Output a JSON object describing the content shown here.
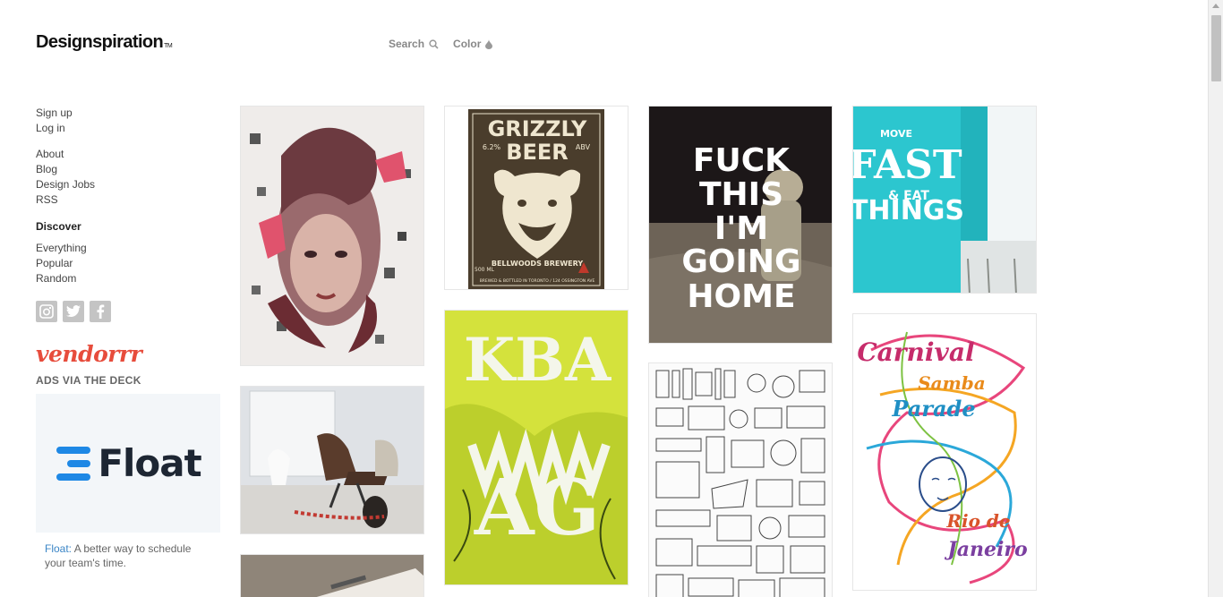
{
  "header": {
    "logo": "Designspiration",
    "logo_tm": "TM",
    "nav": [
      {
        "label": "Search",
        "icon": "search-icon"
      },
      {
        "label": "Color",
        "icon": "droplet-icon"
      }
    ]
  },
  "sidebar": {
    "account": [
      "Sign up",
      "Log in"
    ],
    "pages": [
      "About",
      "Blog",
      "Design Jobs",
      "RSS"
    ],
    "discover_heading": "Discover",
    "discover": [
      "Everything",
      "Popular",
      "Random"
    ],
    "social": [
      "instagram-icon",
      "twitter-icon",
      "facebook-icon"
    ],
    "vendor_logo": "vendorrr",
    "ads_heading": "ADS VIA THE DECK",
    "ad": {
      "brand": "Float",
      "link_text": "Float:",
      "body": "A better way to schedule your team's time."
    }
  },
  "tiles": [
    {
      "name": "tile-portrait-illustration",
      "caption": ""
    },
    {
      "name": "tile-grizzly-beer",
      "lines": [
        "GRIZZLY",
        "BEER",
        "6.2%",
        "ABV",
        "BELLWOODS BREWERY",
        "500 ML",
        "BREWED & BOTTLED IN TORONTO / 124 OSSINGTON AVE"
      ]
    },
    {
      "name": "tile-astronaut-poster",
      "lines": [
        "FUCK",
        "THIS",
        "I'M",
        "GOING",
        "HOME"
      ]
    },
    {
      "name": "tile-move-fast",
      "lines": [
        "MOVE",
        "FAST",
        "& EAT",
        "THINGS"
      ]
    },
    {
      "name": "tile-lounge-chair"
    },
    {
      "name": "tile-green-typography",
      "lines": [
        "KBA",
        "AG"
      ]
    },
    {
      "name": "tile-tools-illustration"
    },
    {
      "name": "tile-carnival",
      "lines": [
        "Carnival",
        "Samba",
        "Parade",
        "Rio de",
        "Janeiro"
      ]
    },
    {
      "name": "tile-paper-photo"
    }
  ],
  "colors": {
    "accent_link": "#3a85c6",
    "vendor_red": "#e74c3c",
    "float_blue": "#1e88e5",
    "teal_wall": "#2cc6cf"
  }
}
